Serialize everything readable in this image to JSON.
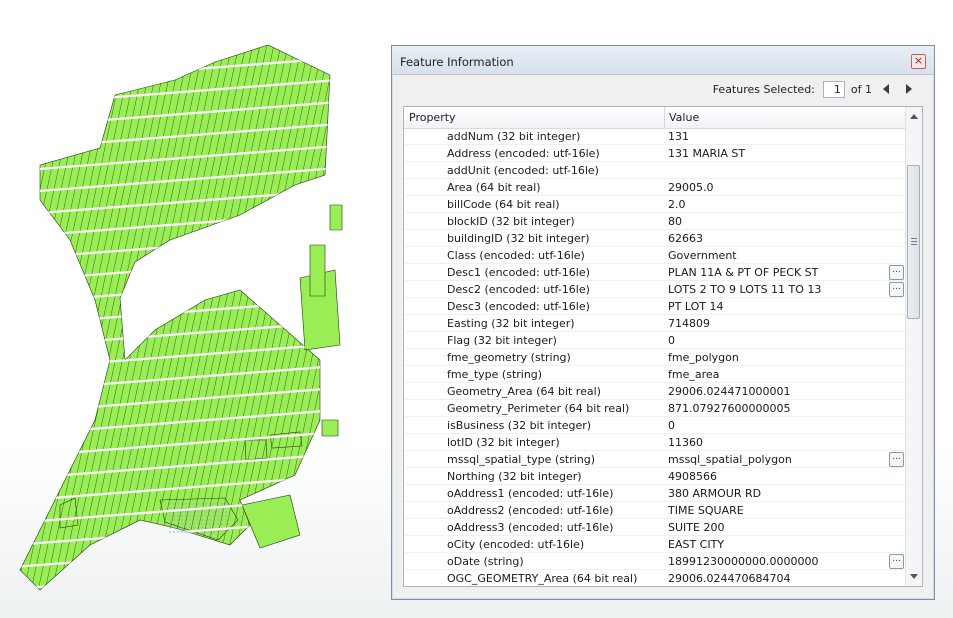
{
  "map": {
    "fill": "#99ee55",
    "stroke": "#1f3a0f",
    "selection_fill": "#b085ff"
  },
  "window": {
    "title": "Feature Information",
    "close_icon": "close-x-icon"
  },
  "selection": {
    "label": "Features Selected:",
    "current": "1",
    "total_text": "of 1"
  },
  "table": {
    "col_property": "Property",
    "col_value": "Value",
    "rows": [
      {
        "prop": "addNum (32 bit integer)",
        "val": "131"
      },
      {
        "prop": "Address (encoded: utf-16le)",
        "val": "131 MARIA ST"
      },
      {
        "prop": "addUnit (encoded: utf-16le)",
        "val": ""
      },
      {
        "prop": "Area (64 bit real)",
        "val": "29005.0"
      },
      {
        "prop": "billCode (64 bit real)",
        "val": "2.0"
      },
      {
        "prop": "blockID (32 bit integer)",
        "val": "80"
      },
      {
        "prop": "buildingID (32 bit integer)",
        "val": "62663"
      },
      {
        "prop": "Class (encoded: utf-16le)",
        "val": "Government"
      },
      {
        "prop": "Desc1 (encoded: utf-16le)",
        "val": "PLAN 11A & PT OF PECK ST",
        "more": true
      },
      {
        "prop": "Desc2 (encoded: utf-16le)",
        "val": "LOTS 2 TO 9 LOTS 11 TO 13",
        "more": true
      },
      {
        "prop": "Desc3 (encoded: utf-16le)",
        "val": "PT LOT 14"
      },
      {
        "prop": "Easting (32 bit integer)",
        "val": "714809"
      },
      {
        "prop": "Flag (32 bit integer)",
        "val": "0"
      },
      {
        "prop": "fme_geometry (string)",
        "val": "fme_polygon"
      },
      {
        "prop": "fme_type (string)",
        "val": "fme_area"
      },
      {
        "prop": "Geometry_Area (64 bit real)",
        "val": "29006.024471000001"
      },
      {
        "prop": "Geometry_Perimeter (64 bit real)",
        "val": "871.07927600000005"
      },
      {
        "prop": "isBusiness (32 bit integer)",
        "val": "0"
      },
      {
        "prop": "lotID (32 bit integer)",
        "val": "11360"
      },
      {
        "prop": "mssql_spatial_type (string)",
        "val": "mssql_spatial_polygon",
        "more": true
      },
      {
        "prop": "Northing (32 bit integer)",
        "val": "4908566"
      },
      {
        "prop": "oAddress1 (encoded: utf-16le)",
        "val": "380 ARMOUR RD"
      },
      {
        "prop": "oAddress2 (encoded: utf-16le)",
        "val": "TIME SQUARE"
      },
      {
        "prop": "oAddress3 (encoded: utf-16le)",
        "val": "SUITE 200"
      },
      {
        "prop": "oCity (encoded: utf-16le)",
        "val": "EAST CITY"
      },
      {
        "prop": "oDate (string)",
        "val": "18991230000000.0000000",
        "more": true
      },
      {
        "prop": "OGC_GEOMETRY_Area (64 bit real)",
        "val": "29006.024470684704"
      }
    ],
    "more_button_label": "...",
    "scrollbar_icons": [
      "scroll-up-arrow-icon",
      "scroll-down-arrow-icon"
    ]
  }
}
